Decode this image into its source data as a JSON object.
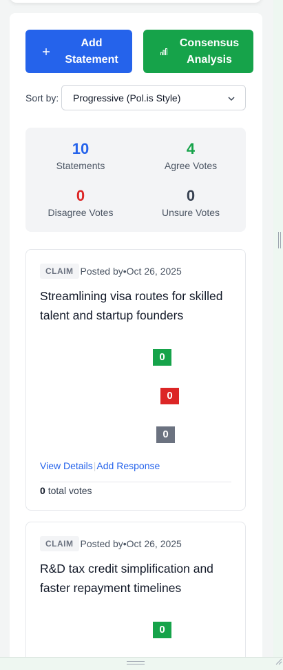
{
  "toolbar": {
    "add_statement_label": "Add Statement",
    "consensus_label": "Consensus Analysis"
  },
  "sort": {
    "label": "Sort by:",
    "selected": "Progressive (Pol.is Style)"
  },
  "stats": {
    "statements": {
      "value": "10",
      "label": "Statements",
      "color": "#2563eb"
    },
    "agree": {
      "value": "4",
      "label": "Agree Votes",
      "color": "#16a34a"
    },
    "disagree": {
      "value": "0",
      "label": "Disagree Votes",
      "color": "#dc2626"
    },
    "unsure": {
      "value": "0",
      "label": "Unsure Votes",
      "color": "#374151"
    }
  },
  "cards": [
    {
      "tag": "CLAIM",
      "posted_by": "Posted by",
      "dot": "•",
      "date": "Oct 26, 2025",
      "title": "Streamlining visa routes for skilled talent and startup founders",
      "agree": "0",
      "disagree": "0",
      "unsure": "0",
      "view_details": "View Details",
      "separator": "|",
      "add_response": "Add Response",
      "total_count": "0",
      "total_label": "total votes"
    },
    {
      "tag": "CLAIM",
      "posted_by": "Posted by",
      "dot": "•",
      "date": "Oct 26, 2025",
      "title": "R&D tax credit simplification and faster repayment timelines",
      "agree": "0"
    }
  ]
}
